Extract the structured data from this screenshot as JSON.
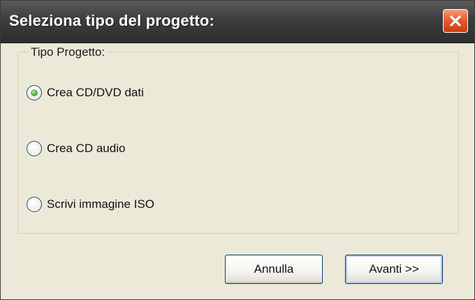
{
  "window": {
    "title": "Seleziona tipo del progetto:",
    "close_icon": "close-x-icon"
  },
  "group": {
    "legend": "Tipo Progetto:"
  },
  "options": [
    {
      "label": "Crea CD/DVD dati",
      "checked": true
    },
    {
      "label": "Crea CD audio",
      "checked": false
    },
    {
      "label": "Scrivi immagine ISO",
      "checked": false
    }
  ],
  "buttons": {
    "cancel_label": "Annulla",
    "next_label": "Avanti >>"
  },
  "colors": {
    "title_bar": "#3d3d3d",
    "close_button": "#e2592f",
    "dialog_background": "#ece9d8",
    "radio_checked": "#3aa32a"
  }
}
